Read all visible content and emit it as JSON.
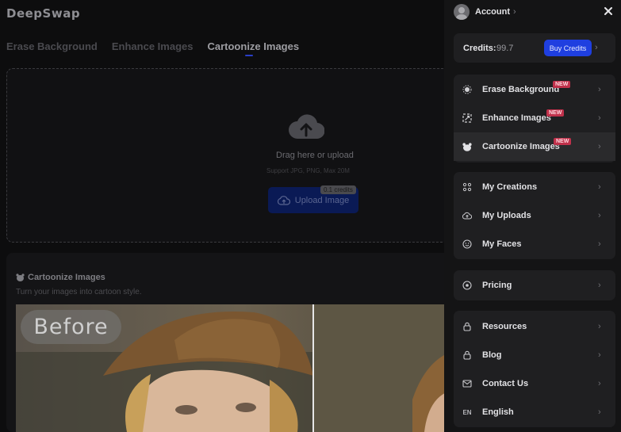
{
  "app": {
    "logo": "DeepSwap",
    "tabs": [
      "Erase Background",
      "Enhance Images",
      "Cartoonize Images"
    ],
    "active_tab": "Cartoonize Images",
    "upload": {
      "drag_text": "Drag here or upload",
      "support_text": "Support JPG, PNG, Max 20M",
      "button_label": "Upload Image",
      "credit_badge": "0.1 credits"
    },
    "section": {
      "title": "Cartoonize Images",
      "subtitle": "Turn your images into cartoon style.",
      "before_label": "Before"
    }
  },
  "drawer": {
    "account_label": "Account",
    "credits_label": "Credits:",
    "credits_value": "99.7",
    "buy_label": "Buy Credits",
    "tools": [
      {
        "label": "Erase Background",
        "icon": "erase-icon",
        "badge": "NEW"
      },
      {
        "label": "Enhance Images",
        "icon": "enhance-icon",
        "badge": "NEW"
      },
      {
        "label": "Cartoonize Images",
        "icon": "bear-icon",
        "badge": "NEW"
      }
    ],
    "library": [
      {
        "label": "My Creations",
        "icon": "grid-dots-icon"
      },
      {
        "label": "My Uploads",
        "icon": "cloud-upload-icon"
      },
      {
        "label": "My Faces",
        "icon": "smile-icon"
      }
    ],
    "pricing": {
      "label": "Pricing",
      "icon": "pricing-icon"
    },
    "more": [
      {
        "label": "Resources",
        "icon": "resources-icon"
      },
      {
        "label": "Blog",
        "icon": "blog-icon"
      },
      {
        "label": "Contact Us",
        "icon": "mail-icon"
      },
      {
        "label": "English",
        "icon": "language-icon",
        "icon_text": "EN"
      }
    ]
  },
  "colors": {
    "accent": "#1f3fe0",
    "new_badge": "#c0314b",
    "drawer_bg": "#141415",
    "card_bg": "#1f1f21"
  }
}
